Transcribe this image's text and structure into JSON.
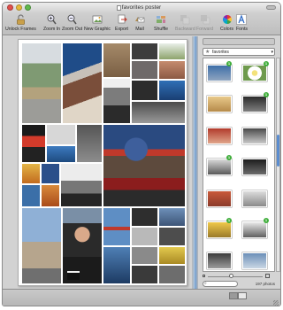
{
  "window": {
    "title": "favorites poster"
  },
  "toolbar": {
    "items": [
      {
        "label": "Unlock Frames",
        "icon": "unlock-icon",
        "enabled": true
      },
      {
        "label": "Zoom In",
        "icon": "zoom-in-icon",
        "enabled": true
      },
      {
        "label": "Zoom Out",
        "icon": "zoom-out-icon",
        "enabled": true
      },
      {
        "label": "New Graphic",
        "icon": "new-graphic-icon",
        "enabled": true
      },
      {
        "label": "Export",
        "icon": "export-icon",
        "enabled": true
      },
      {
        "label": "Mail",
        "icon": "mail-icon",
        "enabled": true
      },
      {
        "label": "Shuffle",
        "icon": "shuffle-icon",
        "enabled": true
      },
      {
        "label": "Backward",
        "icon": "backward-icon",
        "enabled": false
      },
      {
        "label": "Forward",
        "icon": "forward-icon",
        "enabled": false
      },
      {
        "label": "Colors",
        "icon": "color-wheel-icon",
        "enabled": true
      },
      {
        "label": "Fonts",
        "icon": "fonts-icon",
        "enabled": true
      }
    ]
  },
  "sidebar": {
    "source": {
      "label": "favorites"
    },
    "photo_count": "197 photos",
    "thumb_badges": [
      "1",
      "1",
      "1",
      "1",
      "1",
      "1"
    ]
  },
  "colors": {
    "accent": "#5b8dd0",
    "badge": "#3fae3a"
  }
}
